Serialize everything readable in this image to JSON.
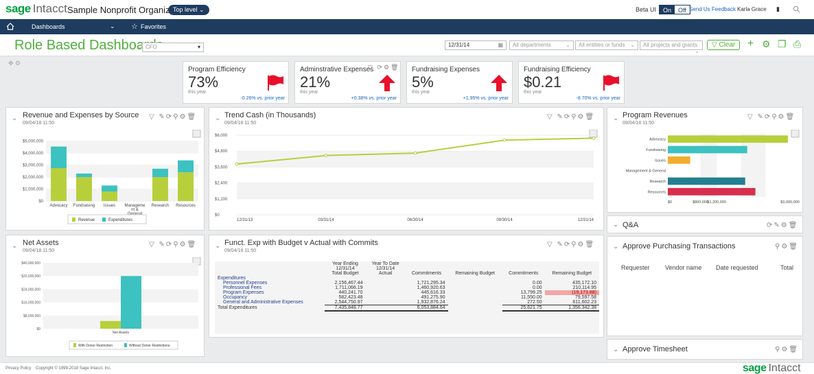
{
  "app": {
    "logo_sage": "sage",
    "logo_intacct": "Intacct",
    "org_name": "Sample Nonprofit Organization",
    "level": "Top level ⌄"
  },
  "topbar": {
    "beta_label": "Beta UI",
    "on": "On",
    "off": "Off",
    "feedback": "Send Us Feedback",
    "user": "Karla Grace"
  },
  "nav": {
    "dashboards": "Dashboards",
    "favorites": "Favorites"
  },
  "header": {
    "title": "Role Based Dashboards",
    "role_select": "CFO",
    "date": "12/31/14",
    "departments": "All departments",
    "entities": "All entities or funds",
    "projects": "All projects and grants",
    "clear": "Clear"
  },
  "kpis": [
    {
      "title": "Program Efficiency",
      "value": "73%",
      "sub": "this year",
      "change": "-0.26% vs. prior year",
      "indicator": "flag"
    },
    {
      "title": "Adminstrative Expenses",
      "value": "21%",
      "sub": "this year",
      "change": "+0.38% vs. prior year",
      "indicator": "arrow"
    },
    {
      "title": "Fundraising Expenses",
      "value": "5%",
      "sub": "this year",
      "change": "+1.95% vs. prior year",
      "indicator": "arrow"
    },
    {
      "title": "Fundraising Efficiency",
      "value": "$0.21",
      "sub": "this year",
      "change": "-8.70% vs. prior year",
      "indicator": "flag"
    }
  ],
  "colors": {
    "green": "#4fb03c",
    "lime": "#b8cf3c",
    "teal": "#3cc2c0",
    "navy": "#1d3c5f",
    "red": "#e8102a",
    "orange": "#f2ad2e",
    "darkteal": "#237f91",
    "crimson": "#d82e4e"
  },
  "panels": {
    "rev_exp": {
      "title": "Revenue and Expenses by Source",
      "date": "09/04/18 11:50"
    },
    "trend": {
      "title": "Trend Cash (in Thousands)",
      "date": "09/04/18 11:50"
    },
    "prog_rev": {
      "title": "Program Revenues",
      "date": "09/04/18 11:50"
    },
    "qa": {
      "title": "Q&A"
    },
    "net_assets": {
      "title": "Net Assets",
      "date": "09/04/18 11:50"
    },
    "funct": {
      "title": "Funct. Exp with Budget v Actual with Commits",
      "date": "09/04/18 11:50"
    },
    "purchasing": {
      "title": "Approve Purchasing Transactions",
      "cols": [
        "Requester",
        "Vendor name",
        "Date requested",
        "Total"
      ]
    },
    "timesheet": {
      "title": "Approve Timesheet"
    }
  },
  "chart_data": [
    {
      "type": "bar",
      "title": "Revenue and Expenses by Source",
      "categories": [
        "Advocacy",
        "Fundraising",
        "Issues",
        "Management & General",
        "Research",
        "Resources"
      ],
      "category_labels": [
        "Advocacy",
        "Fundraising",
        "Issues",
        "Manageme nt & General",
        "Research",
        "Resources"
      ],
      "series": [
        {
          "name": "Revenue",
          "values": [
            2750000,
            2000000,
            800000,
            0,
            2000000,
            2400000
          ]
        },
        {
          "name": "Expenditures",
          "values": [
            1800000,
            300000,
            500000,
            0,
            700000,
            1000000
          ]
        }
      ],
      "stacked": true,
      "ylim": [
        0,
        5500000
      ],
      "yticks": [
        "$0",
        "$1,000,000",
        "$2,000,000",
        "$3,000,000",
        "$4,000,000",
        "$5,000,000"
      ],
      "ytick_values": [
        0,
        1000000,
        2000000,
        3000000,
        4000000,
        5000000
      ],
      "legend": "bottom"
    },
    {
      "type": "line",
      "title": "Trend Cash (in Thousands)",
      "x": [
        "12/31/13",
        "03/31/14",
        "06/30/14",
        "09/30/14",
        "12/31/14"
      ],
      "values": [
        2550,
        2980,
        3100,
        3750,
        3850
      ],
      "ylim": [
        0,
        4000
      ],
      "yticks": [
        "$0",
        "$1,200",
        "$2,400",
        "$3,600",
        "$4,800",
        "$6,000"
      ],
      "ytick_values": [
        0,
        800,
        1600,
        2400,
        3200,
        4000
      ]
    },
    {
      "type": "bar",
      "orientation": "horizontal",
      "title": "Program Revenues",
      "categories": [
        "Advocacy",
        "Fundraising",
        "Issues",
        "Management & General",
        "Research",
        "Resources"
      ],
      "values": [
        2950000,
        1950000,
        550000,
        0,
        1900000,
        2150000
      ],
      "colors": [
        "#b8cf3c",
        "#3cc2c0",
        "#f2ad2e",
        "#ffffff",
        "#237f91",
        "#d82e4e"
      ],
      "xlim": [
        0,
        3000000
      ],
      "xticks": [
        "$0",
        "$800,000",
        "$1,200,000",
        "$3,000,000"
      ],
      "xtick_values": [
        0,
        800000,
        1200000,
        3000000
      ]
    },
    {
      "type": "bar",
      "title": "Net Assets",
      "categories": [
        "Net Assets"
      ],
      "series": [
        {
          "name": "With Donor Restriction",
          "values": [
            4700000
          ]
        },
        {
          "name": "Without Donor Restrictions",
          "values": [
            32000000
          ]
        }
      ],
      "ylim": [
        0,
        40000000
      ],
      "yticks": [
        "$0",
        "$8,000,000",
        "$16,000,000",
        "$24,000,000",
        "$32,000,000",
        "$40,000,000"
      ],
      "ytick_values": [
        0,
        8000000,
        16000000,
        24000000,
        32000000,
        40000000
      ],
      "legend": "bottom"
    }
  ],
  "funct_table": {
    "header_top": [
      "Year Ending",
      "Year To Date"
    ],
    "header_mid": [
      "12/31/14",
      "12/31/14"
    ],
    "headers": [
      "Total Budget",
      "Actual",
      "Commitments",
      "Remaining Budget",
      "Commitments",
      "Remaining Budget"
    ],
    "group": "Expenditures",
    "rows": [
      {
        "label": "Personnel Expenses",
        "total_budget": "2,156,467.44",
        "commitments": "1,721,295.34",
        "commitments2": "0.00",
        "remaining": "435,172.10"
      },
      {
        "label": "Professional Fees",
        "total_budget": "1,711,066.19",
        "commitments": "1,460,920.63",
        "commitments2": "0.00",
        "remaining": "210,114.95"
      },
      {
        "label": "Program Expenses",
        "total_budget": "440,241.70",
        "commitments": "445,616.33",
        "commitments2": "13,799.25",
        "remaining": "(19,173.88)"
      },
      {
        "label": "Occupancy",
        "total_budget": "582,423.48",
        "commitments": "491,275.90",
        "commitments2": "11,550.00",
        "remaining": "79,597.58"
      },
      {
        "label": "General and Administrative Expenses",
        "total_budget": "2,544,750.97",
        "commitments": "1,932,876.24",
        "commitments2": "272.50",
        "remaining": "611,602.23"
      }
    ],
    "total": {
      "label": "Total Expenditures",
      "total_budget": "7,435,848.77",
      "commitments": "6,053,884.64",
      "commitments2": "25,621.75",
      "remaining": "1,356,342.38"
    }
  },
  "footer": {
    "privacy": "Privacy Policy",
    "copyright": "Copyright © 1999-2018 Sage Intacct, Inc.",
    "logo_sage": "sage",
    "logo_intacct": "Intacct"
  }
}
